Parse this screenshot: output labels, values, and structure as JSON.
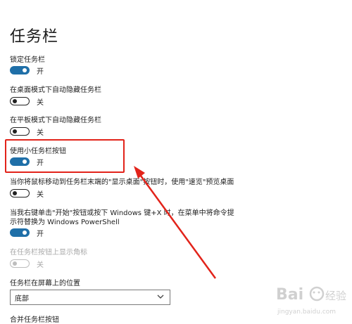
{
  "page": {
    "title": "任务栏"
  },
  "settings": [
    {
      "label": "锁定任务栏",
      "state": "开"
    },
    {
      "label": "在桌面模式下自动隐藏任务栏",
      "state": "关"
    },
    {
      "label": "在平板模式下自动隐藏任务栏",
      "state": "关"
    },
    {
      "label": "使用小任务栏按钮",
      "state": "开"
    },
    {
      "label": "当你将鼠标移动到任务栏末端的\"显示桌面\"按钮时，使用\"速览\"预览桌面",
      "state": "关"
    },
    {
      "label_line1": "当我右键单击\"开始\"按钮或按下 Windows 键+X 时，在菜单中将命令提",
      "label_line2": "示符替换为 Windows PowerShell",
      "state": "开"
    },
    {
      "label": "在任务栏按钮上显示角标",
      "state": "关"
    }
  ],
  "position": {
    "label": "任务栏在屏幕上的位置",
    "value": "底部"
  },
  "bottom_cut_text": "合并任务栏按钮",
  "watermark": {
    "brand": "Bai",
    "brand2": "经验",
    "url": "jingyan.baidu.com"
  },
  "colors": {
    "toggle_on": "#1f6fa8",
    "highlight": "#e2231a",
    "arrow": "#e2231a"
  }
}
